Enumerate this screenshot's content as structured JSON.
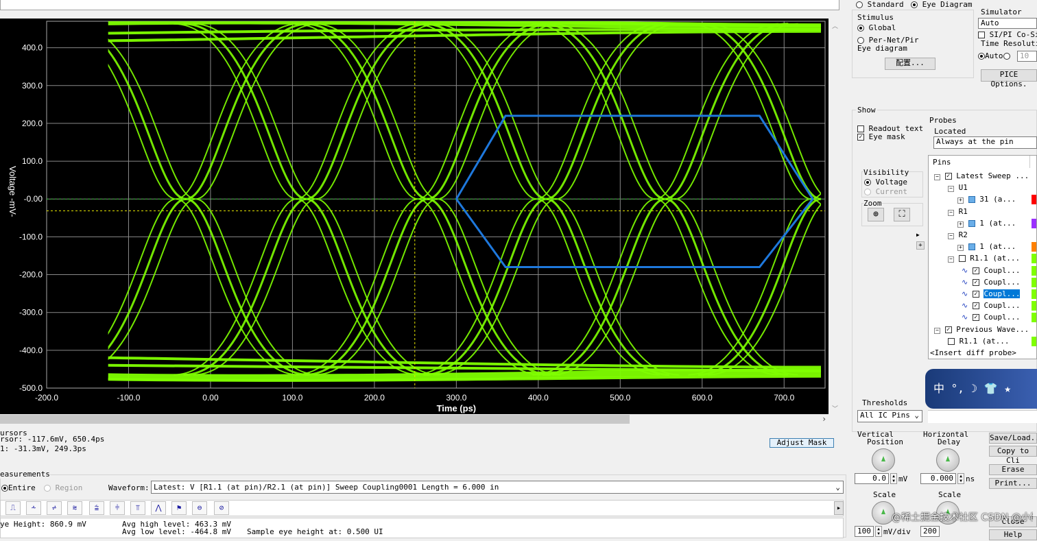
{
  "top": {
    "mode_standard": "Standard",
    "mode_eye": "Eye Diagram"
  },
  "stimulus": {
    "title": "Stimulus",
    "global": "Global",
    "per_net": "Per-Net/Pir",
    "eye_label": "Eye diagram",
    "config_button": "配置..."
  },
  "simulator": {
    "title": "Simulator",
    "value": "Auto",
    "cosim": "SI/PI Co-Sim",
    "time_res": "Time Resolutio",
    "auto": "Auto",
    "res_value": "10",
    "spice_button": "PICE Options."
  },
  "show": {
    "title": "Show",
    "readout": "Readout text",
    "eye_mask": "Eye mask"
  },
  "probes": {
    "title": "Probes",
    "located": "Located",
    "located_value": "Always at the pin"
  },
  "visibility": {
    "title": "Visibility",
    "voltage": "Voltage",
    "current": "Current"
  },
  "zoom": {
    "title": "Zoom"
  },
  "tree": {
    "header": "Pins",
    "rows": [
      {
        "label": "Latest Sweep ...",
        "color": ""
      },
      {
        "label": "U1",
        "color": ""
      },
      {
        "label": "31 (a...",
        "color": "#ff0000"
      },
      {
        "label": "R1",
        "color": ""
      },
      {
        "label": "1 (at...",
        "color": "#9b30ff"
      },
      {
        "label": "R2",
        "color": ""
      },
      {
        "label": "1 (at...",
        "color": "#ff8000"
      },
      {
        "label": "R1.1 (at...",
        "color": "#7fff00"
      },
      {
        "label": "Coupl...",
        "color": "#7fff00"
      },
      {
        "label": "Coupl...",
        "color": "#7fff00"
      },
      {
        "label": "Coupl...",
        "color": "#7fff00"
      },
      {
        "label": "Coupl...",
        "color": "#7fff00"
      },
      {
        "label": "Coupl...",
        "color": "#7fff00"
      },
      {
        "label": "Previous Wave...",
        "color": ""
      },
      {
        "label": "R1.1 (at...",
        "color": "#7fff00"
      },
      {
        "label": "<Insert diff probe>",
        "color": ""
      }
    ]
  },
  "thresholds": {
    "title": "Thresholds",
    "value": "All IC Pins"
  },
  "cursors": {
    "title": "ursors",
    "line1": "rsor: -117.6mV,  650.4ps",
    "line2": "1: -31.3mV,  249.3ps"
  },
  "adjust_mask": "Adjust Mask",
  "measurements": {
    "title": "easurements",
    "entire": "Entire",
    "region": "Region",
    "waveform_label": "Waveform:",
    "waveform_value": "Latest: V [R1.1 (at pin)/R2.1 (at pin)] Sweep Coupling0001 Length = 6.000 in"
  },
  "results": {
    "eye_height": "ye Height: 860.9 mV",
    "avg_high": "Avg high level: 463.3 mV",
    "avg_low": "Avg low level: -464.8 mV",
    "sample": "Sample eye height at: 0.500 UI"
  },
  "vertical": {
    "title1": "Vertical",
    "title2": "Position",
    "pos_value": "0.0",
    "pos_unit": "mV",
    "scale": "Scale",
    "scale_value": "100",
    "scale_unit": "mV/div"
  },
  "horizontal": {
    "title1": "Horizontal",
    "title2": "Delay",
    "delay_value": "0.000",
    "delay_unit": "ns",
    "scale": "Scale",
    "scale_value": "200"
  },
  "buttons": {
    "save_load": "Save/Load..",
    "copy": "Copy to Cli",
    "erase": "Erase",
    "print": "Print...",
    "close": "Close",
    "help": "Help"
  },
  "watermark": "@稀土掘金技术社区  CSDN @小趴余生不加糖",
  "ime": "中 °, ☽ 👕 ★",
  "colors": {
    "trace": "#7fff00",
    "mask": "#1e78dc",
    "plot_bg": "#000000",
    "grid": "#8a8a8a",
    "cursor": "#e6e600"
  },
  "chart_data": {
    "type": "line",
    "xlabel": "Time (ps)",
    "ylabel": "Voltage  -mV-",
    "xlim": [
      -200,
      750
    ],
    "ylim": [
      -500,
      470
    ],
    "xticks": [
      "-200.0",
      "-100.0",
      "0.00",
      "100.0",
      "200.0",
      "300.0",
      "400.0",
      "500.0",
      "600.0",
      "700.0"
    ],
    "yticks": [
      "400.0",
      "300.0",
      "200.0",
      "100.0",
      "-0.00",
      "-100.0",
      "-200.0",
      "-300.0",
      "-400.0",
      "-500.0"
    ],
    "ytick_values": [
      400,
      300,
      200,
      100,
      0,
      -100,
      -200,
      -300,
      -400,
      -500
    ],
    "xtick_values": [
      -200,
      -100,
      0,
      100,
      200,
      300,
      400,
      500,
      600,
      700
    ],
    "data_start": -125,
    "data_end": 750,
    "high_level": 463.3,
    "low_level": -464.8,
    "crossings": [
      -30,
      117,
      265,
      410,
      555,
      745
    ],
    "eye_mask": {
      "x": [
        300,
        360,
        670,
        735,
        670,
        360,
        300
      ],
      "y": [
        0,
        220,
        220,
        0,
        -180,
        -180,
        0
      ]
    },
    "cursors": {
      "x": 249.3,
      "y": -31.3
    }
  }
}
